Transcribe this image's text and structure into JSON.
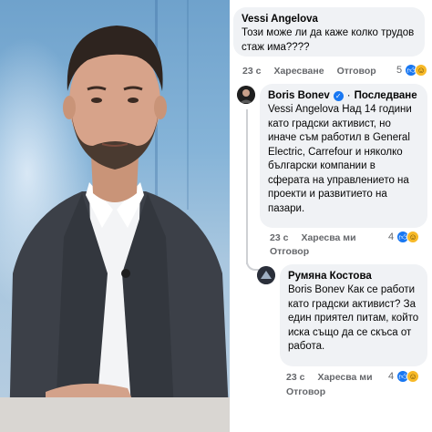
{
  "comments": [
    {
      "author": "Vessi Angelova",
      "text": "Този може ли да каже колко трудов стаж има????",
      "time": "23 с",
      "like_label": "Харесване",
      "reply_label": "Отговор",
      "reaction_count": "5"
    },
    {
      "author": "Boris Bonev",
      "verified": true,
      "follow_label": "Последване",
      "separator": "·",
      "mention": "Vessi Angelova",
      "text": "Над 14 години като градски активист, но иначе съм работил в General Electric, Carrefour и няколко български компании в сферата на управлението на проекти и развитието на пазари.",
      "time": "23 с",
      "like_label": "Харесва ми",
      "reply_label": "Отговор",
      "reaction_count": "4"
    },
    {
      "author": "Румяна Костова",
      "mention": "Boris Bonev",
      "text": "Как се работи като градски активист? За един приятел питам,  който иска също да се скъса от работа.",
      "time": "23 с",
      "like_label": "Харесва ми",
      "reply_label": "Отговор",
      "reaction_count": "4"
    }
  ],
  "icons": {
    "like": "like-icon",
    "haha": "haha-icon",
    "verified": "verified-badge-icon"
  },
  "colors": {
    "bubble": "#f0f2f5",
    "meta_text": "#65676b",
    "like_blue": "#1877f2",
    "haha_yellow": "#f7b928"
  }
}
